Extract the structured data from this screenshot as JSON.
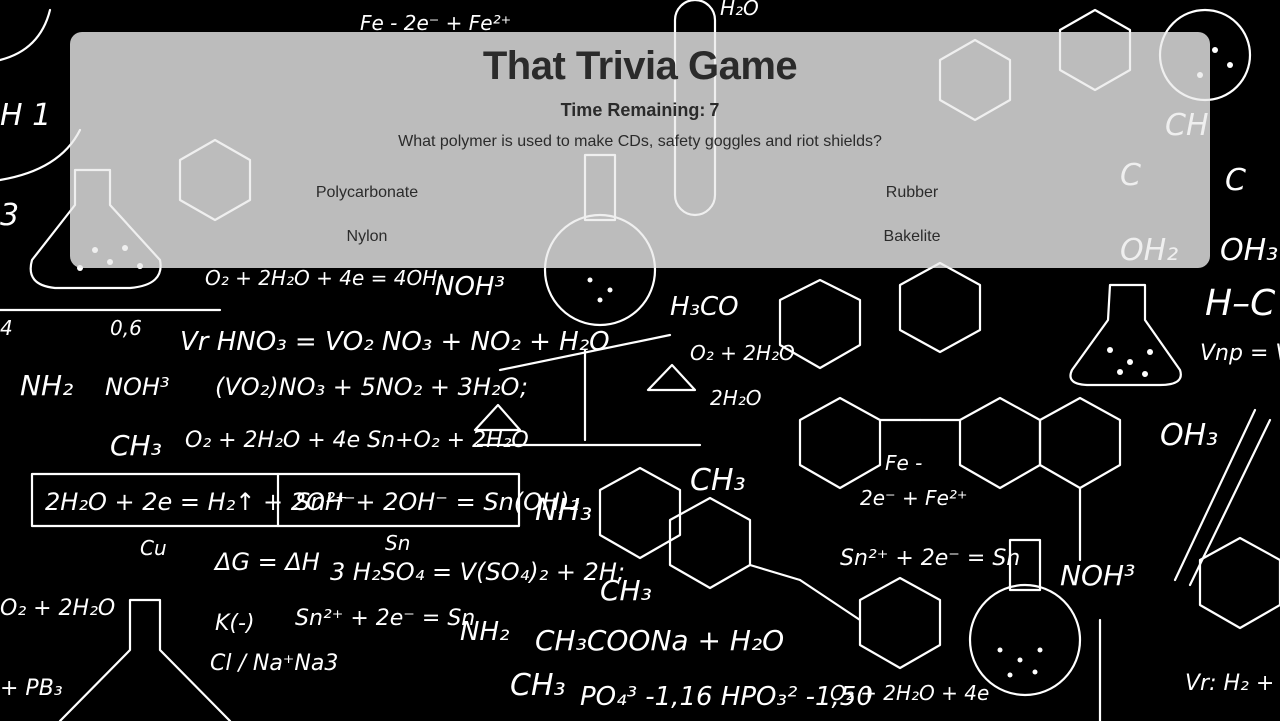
{
  "game": {
    "title": "That Trivia Game",
    "timer_label": "Time Remaining:",
    "timer_value": "7",
    "question": "What polymer is used to make CDs, safety goggles and riot shields?",
    "answers": [
      "Polycarbonate",
      "Rubber",
      "Nylon",
      "Bakelite"
    ]
  },
  "background": {
    "style": "chalkboard chemistry formulas",
    "colors": {
      "background": "#000000",
      "chalk": "#ffffff",
      "panel": "#ebebeb"
    }
  }
}
